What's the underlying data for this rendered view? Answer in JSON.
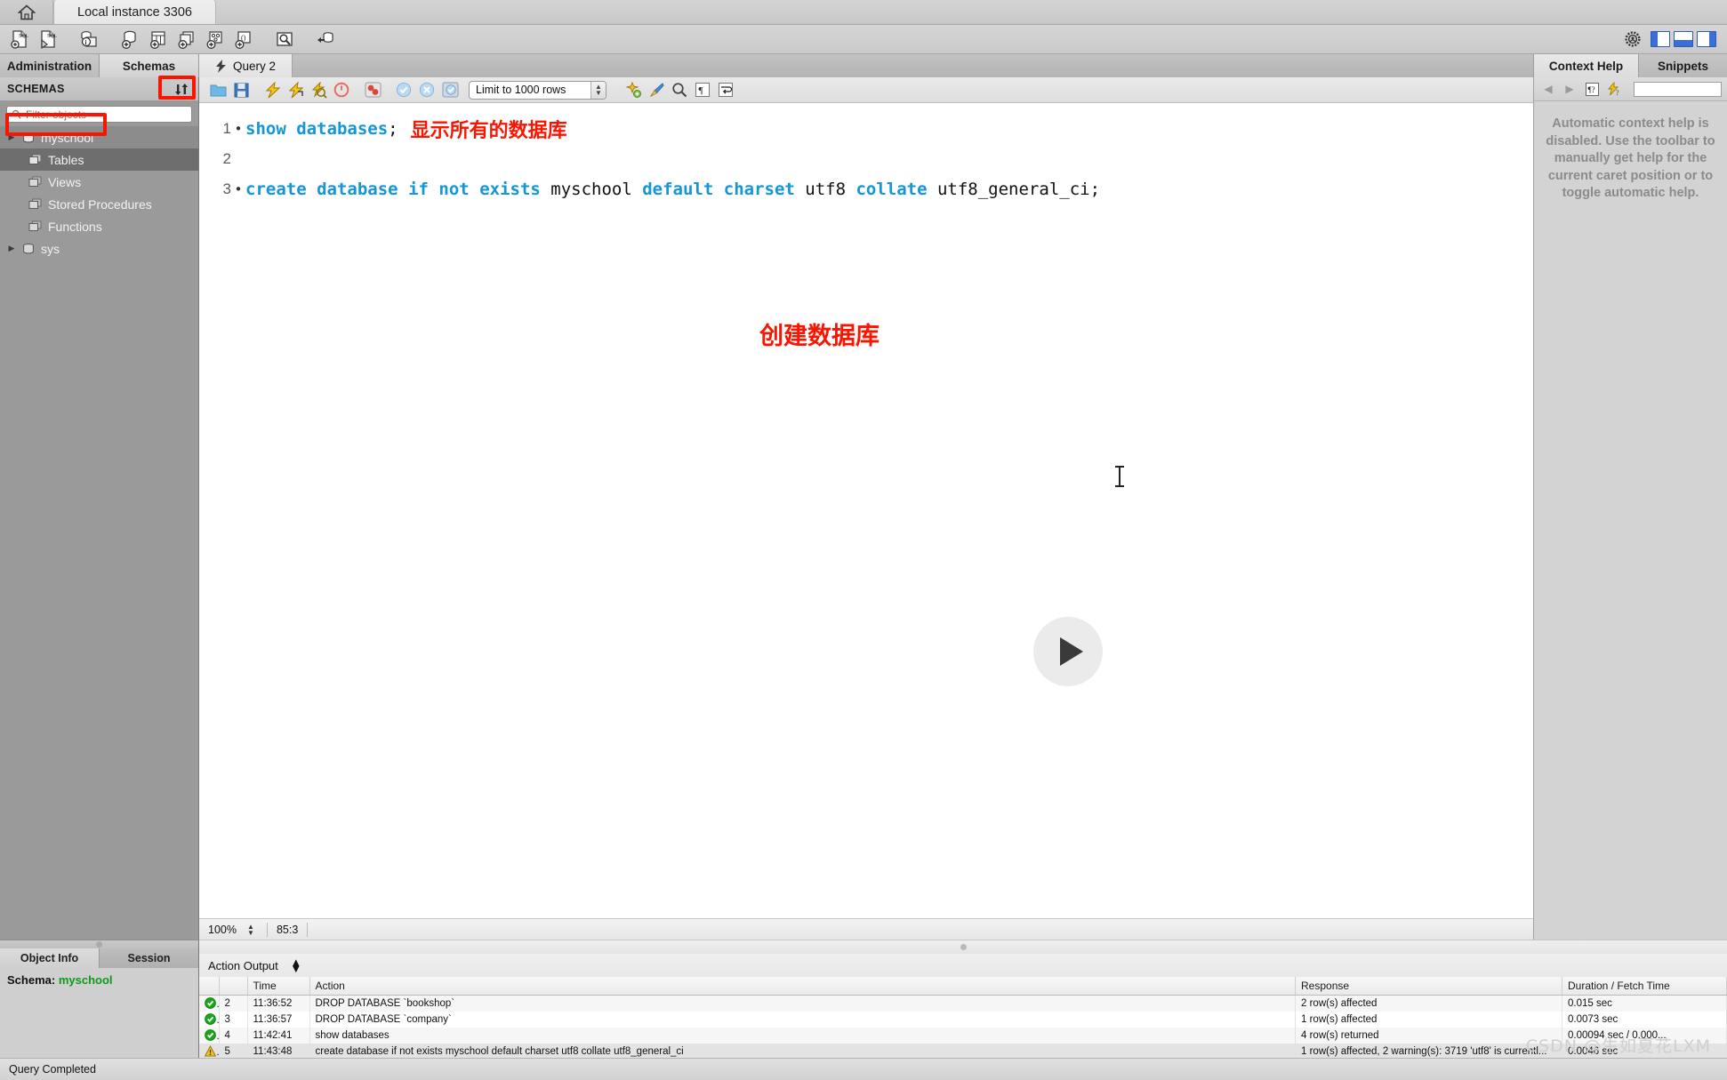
{
  "window": {
    "home_icon": "home-icon",
    "instance_tab": "Local instance 3306"
  },
  "main_toolbar": {
    "icons": [
      "new-sql-tab-icon",
      "open-sql-script-icon",
      "server-info-icon",
      "new-schema-icon",
      "new-table-icon",
      "new-view-icon",
      "new-procedure-icon",
      "new-function-icon",
      "search-data-icon",
      "reconnect-server-icon"
    ],
    "right_icons": [
      "settings-gear-icon",
      "toggle-sidebar-icon",
      "toggle-output-icon",
      "toggle-secondary-sidebar-icon"
    ]
  },
  "left_tabs": [
    {
      "label": "Administration",
      "selected": false
    },
    {
      "label": "Schemas",
      "selected": true
    }
  ],
  "editor_tabs": [
    {
      "label": "Query 2",
      "icon": "lightning-icon",
      "selected": true
    }
  ],
  "right_tabs": [
    {
      "label": "Context Help",
      "selected": true
    },
    {
      "label": "Snippets",
      "selected": false
    }
  ],
  "sidebar": {
    "title": "SCHEMAS",
    "refresh_icon": "refresh-icon",
    "filter": {
      "placeholder": "Filter objects",
      "value": "",
      "icon": "search-icon"
    },
    "tree": [
      {
        "label": "myschool",
        "icon": "schema-icon",
        "level": 1,
        "arrow": "▶",
        "state": "highlighted"
      },
      {
        "label": "Tables",
        "icon": "folder-objects-icon",
        "level": 2,
        "state": "selected"
      },
      {
        "label": "Views",
        "icon": "folder-objects-icon",
        "level": 2,
        "state": "normal"
      },
      {
        "label": "Stored Procedures",
        "icon": "folder-objects-icon",
        "level": 2,
        "state": "normal"
      },
      {
        "label": "Functions",
        "icon": "folder-objects-icon",
        "level": 2,
        "state": "normal"
      },
      {
        "label": "sys",
        "icon": "schema-icon",
        "level": 1,
        "arrow": "▶",
        "state": "normal"
      }
    ],
    "bottom_tabs": [
      {
        "label": "Object Info",
        "selected": true
      },
      {
        "label": "Session",
        "selected": false
      }
    ],
    "object_info": {
      "label": "Schema:",
      "value": "myschool"
    }
  },
  "editor": {
    "toolbar": {
      "icons": [
        "open-file-icon",
        "save-file-icon",
        "execute-all-icon",
        "execute-current-icon",
        "explain-icon",
        "stop-icon",
        "toggle-stop-on-error-icon",
        "commit-icon",
        "rollback-icon",
        "autocommit-icon"
      ],
      "limit_label": "Limit to 1000 rows",
      "right_icons": [
        "beautify-icon",
        "clear-icon",
        "find-icon",
        "invisible-chars-icon",
        "wrap-lines-icon"
      ]
    },
    "lines": [
      {
        "number": "1",
        "has_dot": true,
        "tokens": [
          {
            "t": "show",
            "k": true
          },
          {
            "t": " ",
            "k": false
          },
          {
            "t": "databases",
            "k": true
          },
          {
            "t": ";",
            "k": false
          }
        ],
        "annotation": "显示所有的数据库"
      },
      {
        "number": "2",
        "has_dot": false,
        "tokens": [],
        "annotation": ""
      },
      {
        "number": "3",
        "has_dot": true,
        "tokens": [
          {
            "t": "create",
            "k": true
          },
          {
            "t": " ",
            "k": false
          },
          {
            "t": "database",
            "k": true
          },
          {
            "t": " ",
            "k": false
          },
          {
            "t": "if",
            "k": true
          },
          {
            "t": " ",
            "k": false
          },
          {
            "t": "not",
            "k": true
          },
          {
            "t": " ",
            "k": false
          },
          {
            "t": "exists",
            "k": true
          },
          {
            "t": " myschool ",
            "k": false
          },
          {
            "t": "default",
            "k": true
          },
          {
            "t": " ",
            "k": false
          },
          {
            "t": "charset",
            "k": true
          },
          {
            "t": " utf8 ",
            "k": false
          },
          {
            "t": "collate",
            "k": true
          },
          {
            "t": " utf8_general_ci;",
            "k": false
          }
        ],
        "annotation": ""
      }
    ],
    "annotation_below": "创建数据库",
    "play_overlay_icon": "play-icon",
    "status": {
      "zoom": "100%",
      "caret_position": "85:3"
    }
  },
  "context_help": {
    "back_icon": "arrow-left-icon",
    "forward_icon": "arrow-right-icon",
    "toolbar_icons": [
      "manual-help-icon",
      "toggle-auto-help-icon"
    ],
    "search_value": "",
    "message": "Automatic context help is disabled. Use the toolbar to manually get help for the current caret position or to toggle automatic help."
  },
  "output": {
    "panel_label": "Action Output",
    "columns": [
      "",
      "",
      "Time",
      "Action",
      "Response",
      "Duration / Fetch Time"
    ],
    "rows": [
      {
        "status": "ok",
        "num": "2",
        "time": "11:36:52",
        "action": "DROP DATABASE `bookshop`",
        "response": "2 row(s) affected",
        "duration": "0.015 sec"
      },
      {
        "status": "ok",
        "num": "3",
        "time": "11:36:57",
        "action": "DROP DATABASE `company`",
        "response": "1 row(s) affected",
        "duration": "0.0073 sec"
      },
      {
        "status": "ok",
        "num": "4",
        "time": "11:42:41",
        "action": "show databases",
        "response": "4 row(s) returned",
        "duration": "0.00094 sec / 0.000..."
      },
      {
        "status": "warning",
        "num": "5",
        "time": "11:43:48",
        "action": "create database if not exists myschool default charset utf8 collate utf8_general_ci",
        "response": "1 row(s) affected, 2 warning(s): 3719 'utf8' is currentl...",
        "duration": "0.0046 sec"
      }
    ]
  },
  "statusbar": {
    "message": "Query Completed"
  },
  "watermark": "CSDN @生如夏花LXM",
  "colors": {
    "keyword_blue": "#1596d6",
    "annotation_red": "#fb1400",
    "schema_green": "#0d9a18",
    "panel_gray": "#9a9a9a"
  }
}
